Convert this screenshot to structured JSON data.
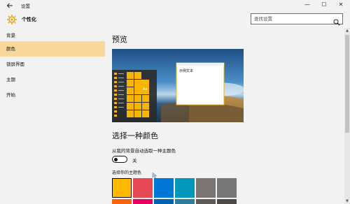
{
  "window": {
    "title": "设置",
    "back_icon": "back-arrow-icon",
    "controls": {
      "minimize": "—",
      "maximize": "☐",
      "close": "✕"
    }
  },
  "header": {
    "section_title": "个性化",
    "icon": "gear-icon",
    "search_placeholder": "查找设置",
    "search_icon": "search-icon"
  },
  "sidebar": {
    "items": [
      {
        "label": "背景",
        "active": false
      },
      {
        "label": "颜色",
        "active": true
      },
      {
        "label": "锁屏界面",
        "active": false
      },
      {
        "label": "主题",
        "active": false
      },
      {
        "label": "开始",
        "active": false
      }
    ],
    "active_color": "#f7d79a"
  },
  "main": {
    "preview_heading": "预览",
    "preview": {
      "start_tile_text": "Aa",
      "sample_window_text": "示例文本",
      "accent_color": "#f8b500"
    },
    "choose_heading": "选择一种颜色",
    "auto_pick_label": "从我的背景自动选取一种主题色",
    "toggle_state": "关",
    "toggle_on": false,
    "theme_color_label": "选择你的主题色",
    "swatches": [
      {
        "color": "#ffb900",
        "selected": true
      },
      {
        "color": "#e74856",
        "selected": false
      },
      {
        "color": "#0078d7",
        "selected": false
      },
      {
        "color": "#0099bc",
        "selected": false
      },
      {
        "color": "#7a7574",
        "selected": false
      },
      {
        "color": "#767676",
        "selected": false
      }
    ],
    "swatches_row2": [
      "#f7630c",
      "#ea005e",
      "#0063b1",
      "#2d7d9a",
      "#5d5a58",
      "#4c4a48"
    ]
  }
}
